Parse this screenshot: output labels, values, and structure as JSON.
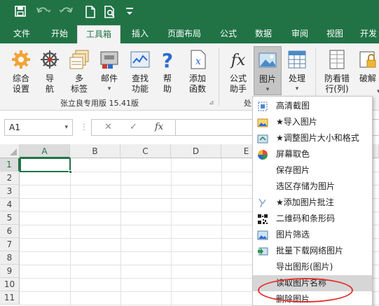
{
  "qat": {
    "icons": [
      "save-icon",
      "undo-icon",
      "redo-icon",
      "new-doc-icon",
      "print-preview-icon",
      "customize-icon"
    ]
  },
  "tabs": [
    "文件",
    "开始",
    "工具箱",
    "插入",
    "页面布局",
    "公式",
    "数据",
    "审阅",
    "视图",
    "开发"
  ],
  "active_tab": "工具箱",
  "ribbon": {
    "group1": {
      "buttons": [
        "综合\n设置",
        "导\n航",
        "多\n标签",
        "邮件",
        "查找\n功能",
        "帮\n助",
        "添加\n函数"
      ],
      "label": "张立良专用版 15.41版"
    },
    "group2": {
      "buttons": [
        "公式\n助手",
        "图片",
        "处理"
      ],
      "label_partial": "处"
    },
    "group3": {
      "buttons": [
        "防看错\n行(列)",
        "破解"
      ]
    }
  },
  "formula_bar": {
    "name_box": "A1",
    "fx": "fx",
    "cancel": "✕",
    "confirm": "✓"
  },
  "columns": [
    "A",
    "B",
    "C",
    "D",
    "E"
  ],
  "rows": [
    "1",
    "2",
    "3",
    "4",
    "5",
    "6",
    "7",
    "8",
    "9",
    "10",
    "11"
  ],
  "menu": {
    "items": [
      {
        "label": "高清截图",
        "icon": "screenshot-icon"
      },
      {
        "label": "★导入图片",
        "icon": "import-image-icon"
      },
      {
        "label": "★调整图片大小和格式",
        "icon": "resize-image-icon"
      },
      {
        "label": "屏幕取色",
        "icon": "color-picker-icon"
      },
      {
        "label": "保存图片",
        "icon": ""
      },
      {
        "label": "选区存储为图片",
        "icon": ""
      },
      {
        "label": "★添加图片批注",
        "icon": "image-comment-icon"
      },
      {
        "label": "二维码和条形码",
        "icon": "qrcode-icon"
      },
      {
        "label": "图片筛选",
        "icon": "image-filter-icon"
      },
      {
        "label": "批量下载网络图片",
        "icon": "download-image-icon"
      },
      {
        "label": "导出图形(图片)",
        "icon": ""
      },
      {
        "label": "读取图片名称",
        "icon": ""
      },
      {
        "label": "删除图片",
        "icon": ""
      }
    ],
    "highlighted_index": 11,
    "highlight_color": "#e0312f"
  },
  "colors": {
    "brand": "#217346"
  }
}
